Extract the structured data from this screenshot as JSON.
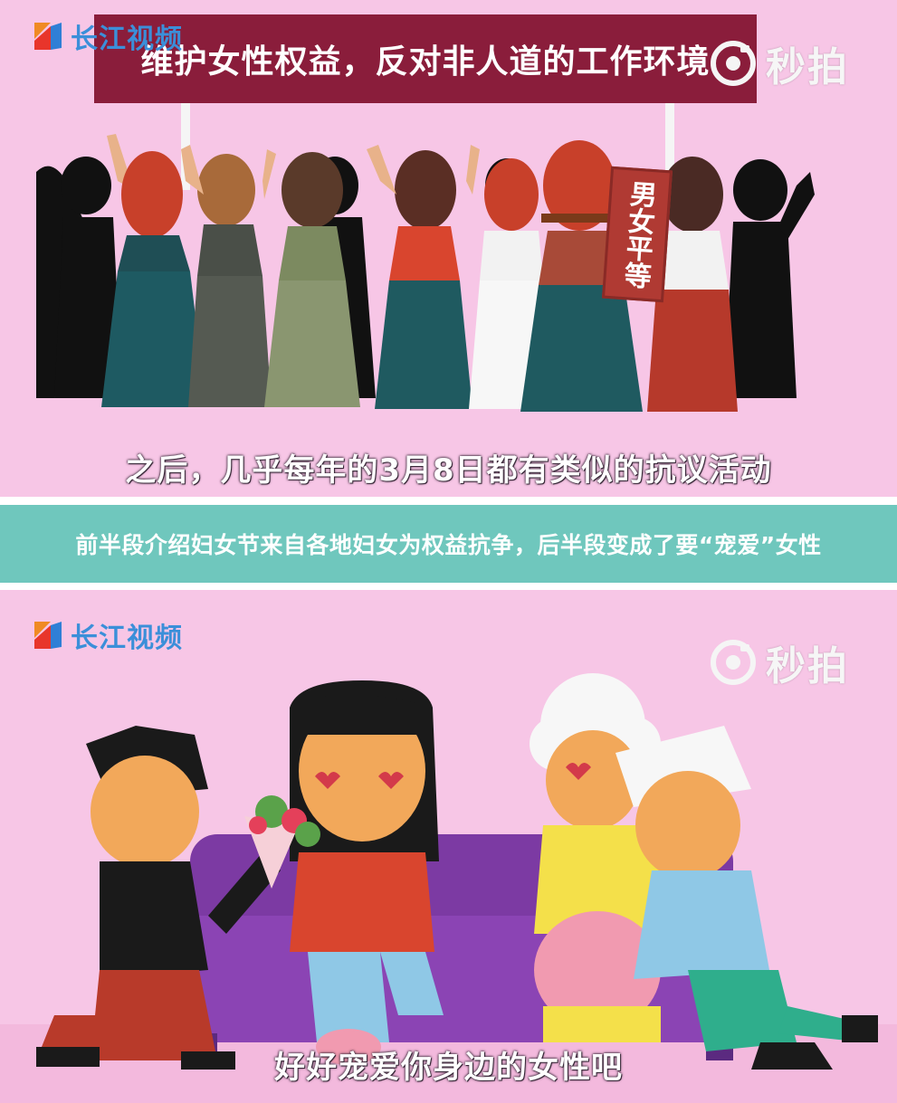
{
  "top_panel": {
    "logo_text": "长江视频",
    "watermark_text": "秒拍",
    "banner_text": "维护女性权益，反对非人道的工作环境",
    "sign_text": "男女平等",
    "subtitle": "之后，几乎每年的3月8日都有类似的抗议活动"
  },
  "caption": {
    "text": "前半段介绍妇女节来自各地妇女为权益抗争，后半段变成了要“宠爱”女性"
  },
  "bottom_panel": {
    "logo_text": "长江视频",
    "watermark_text": "秒拍",
    "subtitle": "好好宠爱你身边的女性吧"
  },
  "colors": {
    "panel_bg": "#f7c6e6",
    "banner": "#8a1d3b",
    "caption_bar": "#6fc7bd",
    "logo_blue": "#3b8fd9",
    "sofa": "#7c3aa3"
  },
  "icons": [
    "changjiang-logo-icon",
    "miaopai-camera-icon"
  ]
}
